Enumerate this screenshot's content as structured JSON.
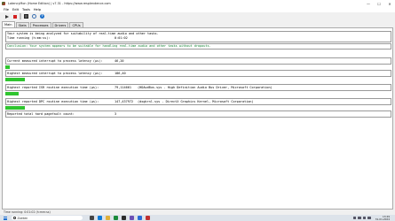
{
  "window": {
    "title": "LatencyMon (Home Edition) | v7.31 - https://www.resplendence.com",
    "controls": {
      "minimize": "—",
      "maximize": "☐",
      "close": "✕"
    }
  },
  "menu": [
    "File",
    "Edit",
    "Tools",
    "Help"
  ],
  "tabs": [
    "Main",
    "Stats",
    "Processes",
    "Drivers",
    "CPUs"
  ],
  "status": {
    "message": "Your system is being analyzed for suitability of real-time audio and other tasks.",
    "time_label": "Time running (h:mm:ss):",
    "time_value": "0:01:02"
  },
  "conclusion": "Conclusion: Your system appears to be suitable for handling real-time audio and other tasks without dropouts.",
  "metrics": [
    {
      "label": "Current measured interrupt to process latency (µs):",
      "value": "46,20",
      "extra": "",
      "bar_fraction": 0.012
    },
    {
      "label": "Highest measured interrupt to process latency (µs):",
      "value": "186,40",
      "extra": "",
      "bar_fraction": 0.05
    },
    {
      "label": "Highest reported ISR routine execution time (µs):",
      "value": "79,114661",
      "extra": "(HDAudBus.sys - High Definition Audio Bus Driver, Microsoft Corporation)",
      "bar_fraction": 0.035
    },
    {
      "label": "Highest reported DPC routine execution time (µs):",
      "value": "147,437972",
      "extra": "(dxgkrnl.sys - DirectX Graphics Kernel, Microsoft Corporation)",
      "bar_fraction": 0.05
    },
    {
      "label": "Reported total hard pagefault count:",
      "value": "3",
      "extra": "",
      "bar_fraction": 0
    }
  ],
  "statusbar": "Time running: 0:01:02  (h:mm:ss)",
  "taskbar": {
    "search_placeholder": "Zoeken",
    "time": "13:29",
    "date": "31-01-2024"
  },
  "colors": {
    "bar": "#2fc52f",
    "conclusion": "#0a7d2c"
  }
}
